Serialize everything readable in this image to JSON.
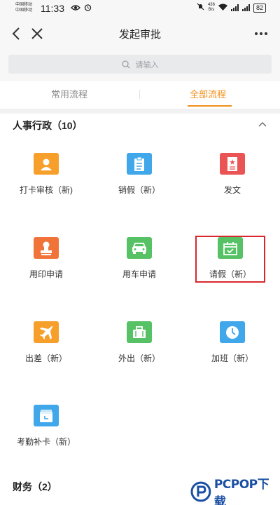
{
  "status_bar": {
    "carrier_1": "中国移动",
    "carrier_2": "中国移动",
    "time": "11:33",
    "net_speed_value": "436",
    "net_speed_unit": "B/s",
    "battery": "82"
  },
  "header": {
    "title": "发起审批"
  },
  "search": {
    "placeholder": "请输入"
  },
  "tabs": [
    {
      "label": "常用流程",
      "active": false
    },
    {
      "label": "全部流程",
      "active": true
    }
  ],
  "sections": [
    {
      "title": "人事行政（10）",
      "items": [
        {
          "label": "打卡审核（新)",
          "icon": "person-icon",
          "color": "#f6a02b"
        },
        {
          "label": "销假（新）",
          "icon": "clipboard-icon",
          "color": "#3fa7ea"
        },
        {
          "label": "发文",
          "icon": "document-icon",
          "color": "#eb5454"
        },
        {
          "label": "用印申请",
          "icon": "stamp-icon",
          "color": "#f0733a"
        },
        {
          "label": "用车申请",
          "icon": "car-icon",
          "color": "#56c265"
        },
        {
          "label": "请假（新）",
          "icon": "calendar-check-icon",
          "color": "#56c265"
        },
        {
          "label": "出差（新）",
          "icon": "airplane-icon",
          "color": "#f6a02b"
        },
        {
          "label": "外出（新）",
          "icon": "briefcase-icon",
          "color": "#56c265"
        },
        {
          "label": "加班（新）",
          "icon": "clock-icon",
          "color": "#3fa7ea"
        },
        {
          "label": "考勤补卡（新）",
          "icon": "attendance-card-icon",
          "color": "#3fa7ea"
        }
      ]
    },
    {
      "title": "财务（2）"
    }
  ],
  "watermark": {
    "text": "PCPOP下载"
  },
  "colors": {
    "accent": "#f09019",
    "highlight": "#d9272d"
  }
}
